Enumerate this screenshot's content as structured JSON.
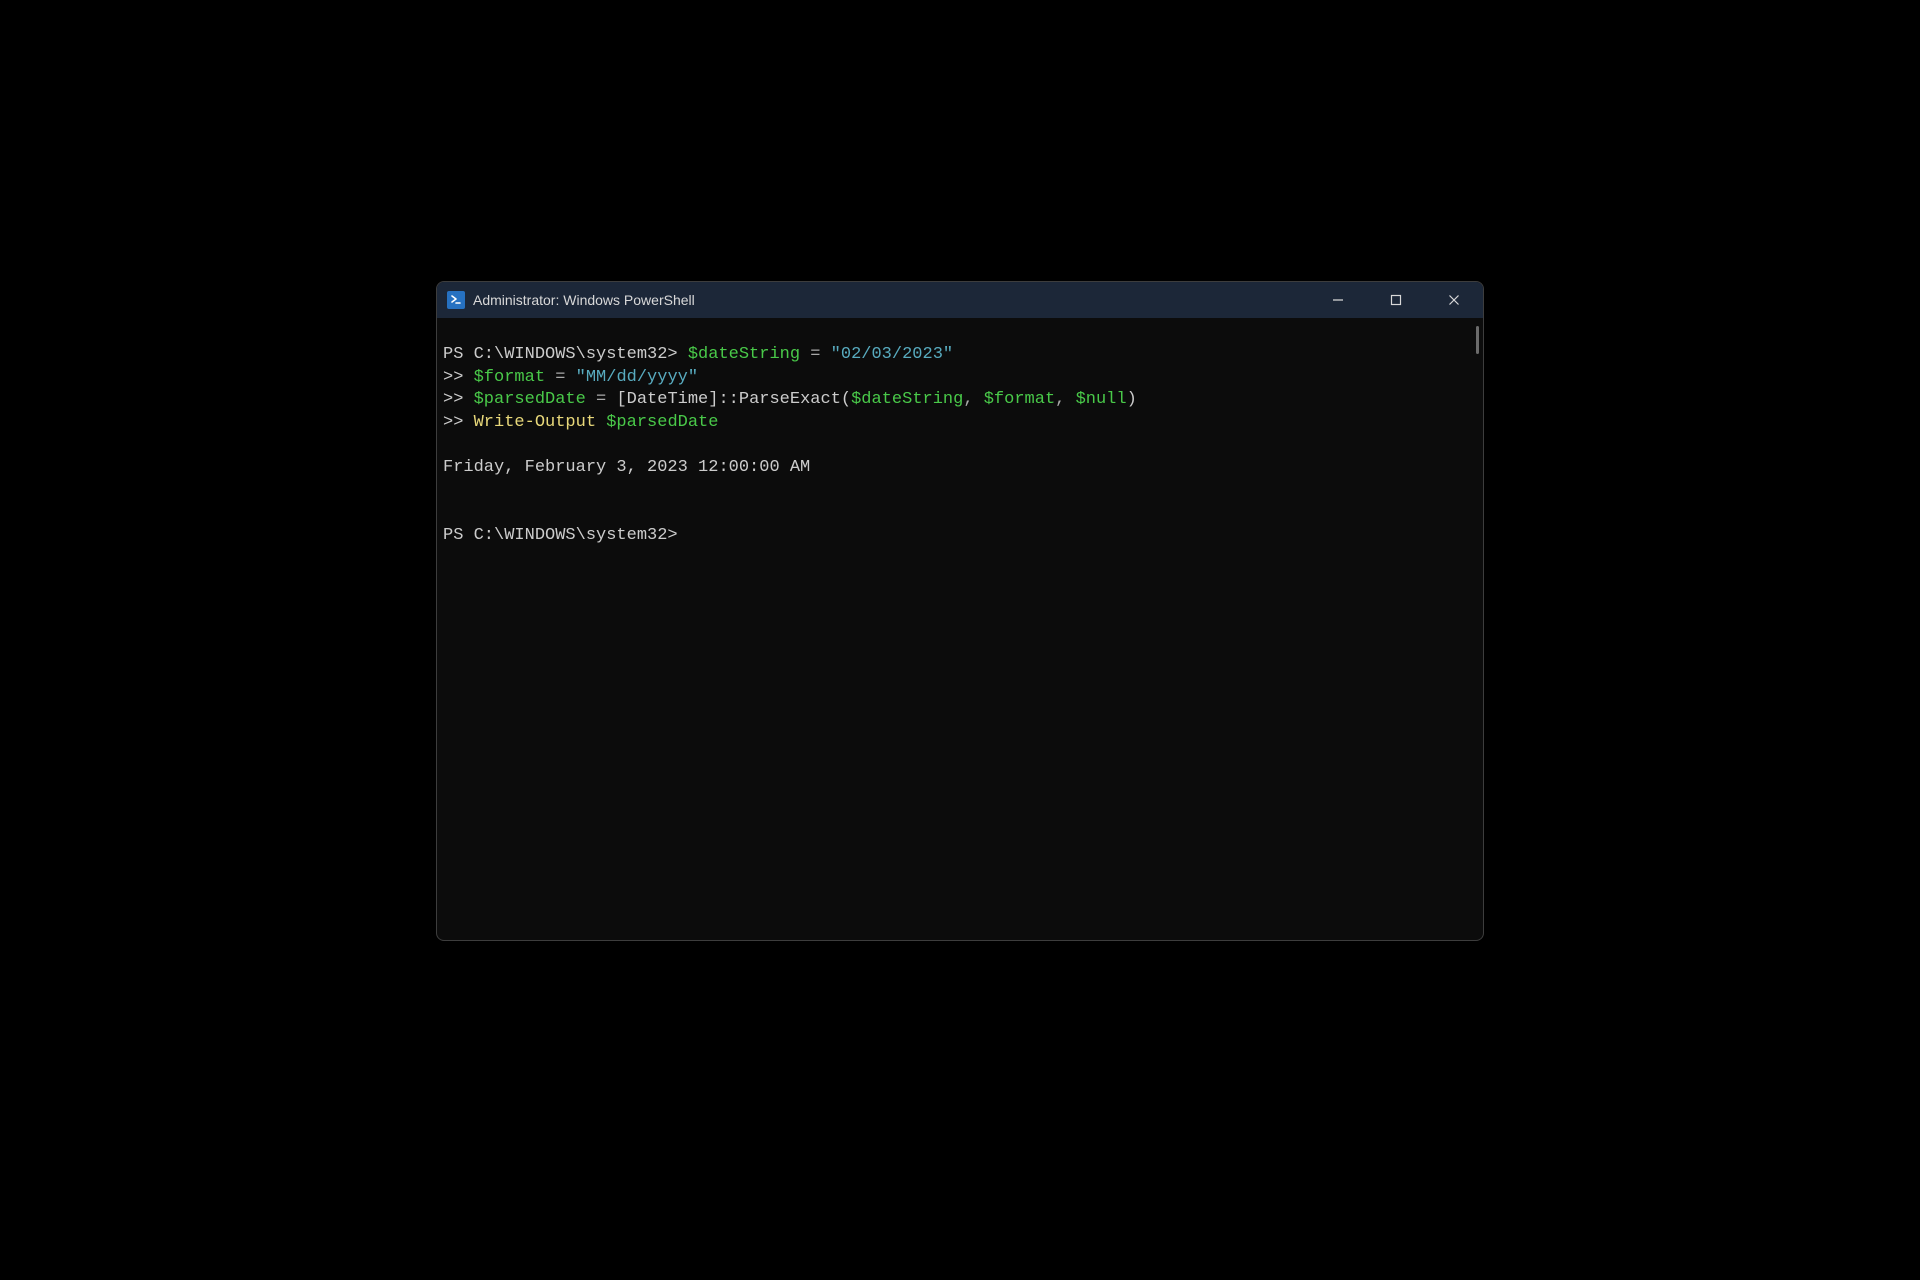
{
  "titlebar": {
    "title": "Administrator: Windows PowerShell"
  },
  "terminal": {
    "line1": {
      "prompt": "PS C:\\WINDOWS\\system32> ",
      "var1": "$dateString",
      "sp1": " ",
      "op": "=",
      "sp2": " ",
      "str": "\"02/03/2023\""
    },
    "line2": {
      "prompt": ">> ",
      "var1": "$format",
      "sp1": " ",
      "op": "=",
      "sp2": " ",
      "str": "\"MM/dd/yyyy\""
    },
    "line3": {
      "prompt": ">> ",
      "var1": "$parsedDate",
      "sp1": " ",
      "op": "=",
      "sp2": " ",
      "call1a": "[",
      "call1b": "DateTime",
      "call1c": "]::",
      "call1d": "ParseExact",
      "call1e": "(",
      "arg1": "$dateString",
      "comma1": ",",
      "sp3": " ",
      "arg2": "$format",
      "comma2": ",",
      "sp4": " ",
      "arg3": "$null",
      "call1f": ")"
    },
    "line4": {
      "prompt": ">> ",
      "cmd": "Write-Output",
      "sp": " ",
      "arg": "$parsedDate"
    },
    "blank1": " ",
    "output1": "Friday, February 3, 2023 12:00:00 AM",
    "blank2": " ",
    "blank3": " ",
    "line5": {
      "prompt": "PS C:\\WINDOWS\\system32>"
    }
  }
}
